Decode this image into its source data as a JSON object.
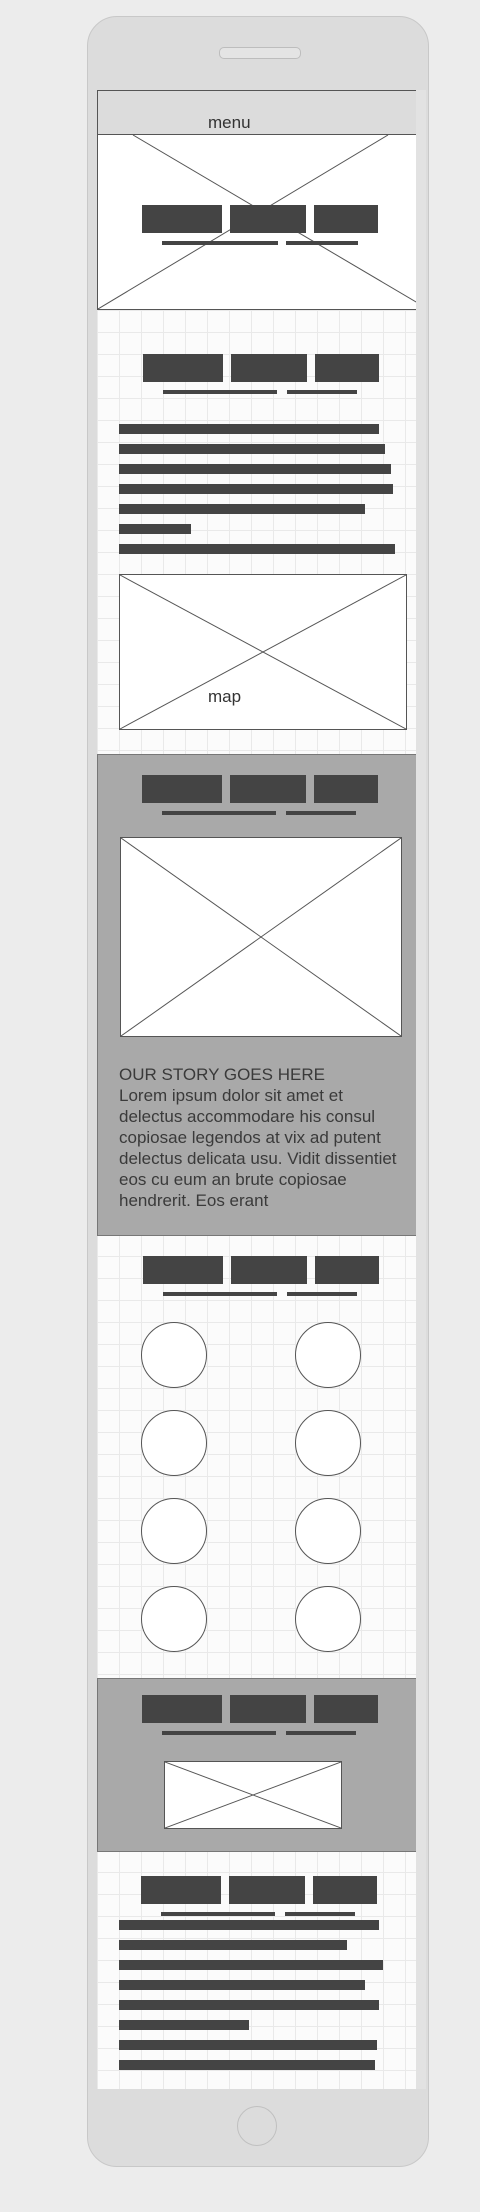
{
  "header": {
    "menu_label": "menu"
  },
  "map_section": {
    "map_label": "map"
  },
  "story_section": {
    "title": "OUR STORY GOES HERE",
    "body": "Lorem ipsum dolor sit amet et delectus accommodare his consul copiosae legendos at vix ad putent delectus delicata usu. Vidit dissentiet eos cu eum an brute copiosae hendrerit. Eos erant"
  },
  "team_section": {
    "circle_count": 8
  },
  "colors": {
    "block": "#444444",
    "grey_section": "#a9a9a9",
    "device": "#dcdcdc"
  }
}
